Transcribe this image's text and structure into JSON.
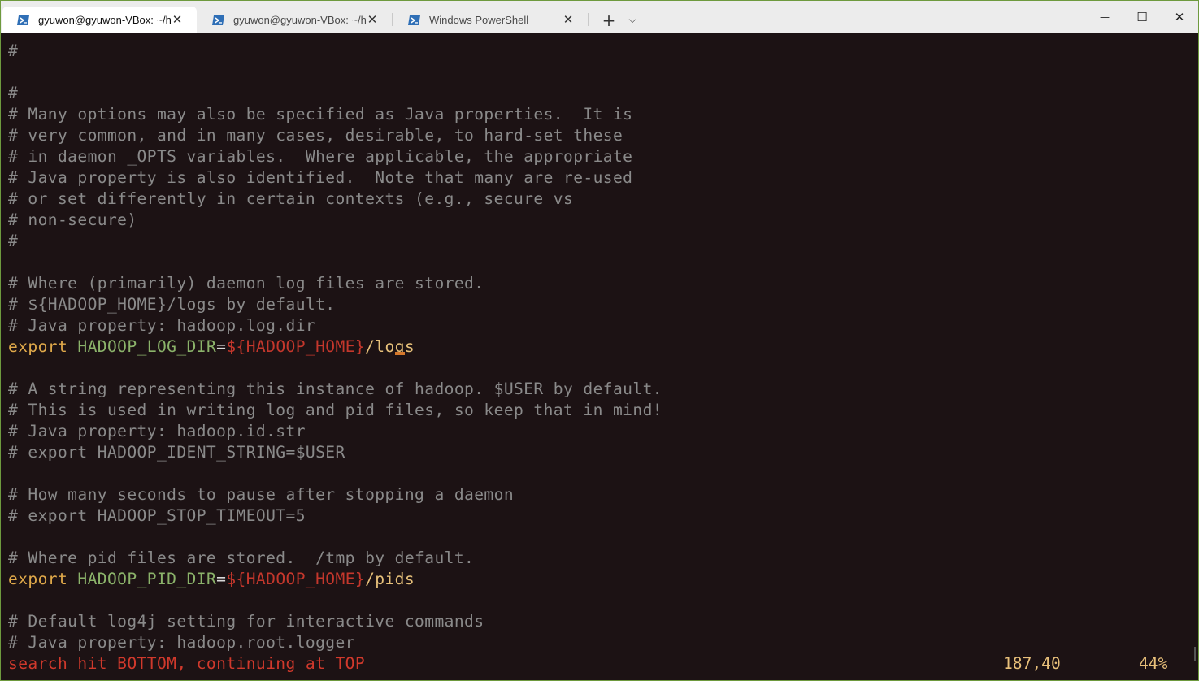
{
  "tabs": [
    {
      "label": "gyuwon@gyuwon-VBox: ~/h",
      "active": true,
      "icon": "powershell-icon"
    },
    {
      "label": "gyuwon@gyuwon-VBox: ~/ha",
      "active": false,
      "icon": "powershell-icon"
    },
    {
      "label": "Windows PowerShell",
      "active": false,
      "icon": "powershell-icon"
    }
  ],
  "tabbar": {
    "new_tab": "+",
    "dropdown": "⌵"
  },
  "window_controls": {
    "minimize": "—",
    "maximize": "☐",
    "close": "✕"
  },
  "colors": {
    "accent_border": "#6e9a3e",
    "terminal_bg": "#1c1214",
    "comment": "#8a8a8a",
    "keyword": "#e0a94a",
    "variable": "#8bb36a",
    "reference": "#c4372c",
    "error": "#d1392c"
  },
  "editor": {
    "lines": [
      "#",
      "",
      "#",
      "# Many options may also be specified as Java properties.  It is",
      "# very common, and in many cases, desirable, to hard-set these",
      "# in daemon _OPTS variables.  Where applicable, the appropriate",
      "# Java property is also identified.  Note that many are re-used",
      "# or set differently in certain contexts (e.g., secure vs",
      "# non-secure)",
      "#",
      "",
      "# Where (primarily) daemon log files are stored.",
      "# ${HADOOP_HOME}/logs by default.",
      "# Java property: hadoop.log.dir",
      "",
      "",
      "# A string representing this instance of hadoop. $USER by default.",
      "# This is used in writing log and pid files, so keep that in mind!",
      "# Java property: hadoop.id.str",
      "# export HADOOP_IDENT_STRING=$USER",
      "",
      "# How many seconds to pause after stopping a daemon",
      "# export HADOOP_STOP_TIMEOUT=5",
      "",
      "# Where pid files are stored.  /tmp by default.",
      "",
      "",
      "# Default log4j setting for interactive commands",
      "# Java property: hadoop.root.logger"
    ],
    "export_log": {
      "keyword": "export",
      "name": "HADOOP_LOG_DIR",
      "eq": "=",
      "ref": "${HADOOP_HOME}",
      "path_a": "/lo",
      "path_cursor": "g",
      "path_b": "s"
    },
    "export_pid": {
      "keyword": "export",
      "name": "HADOOP_PID_DIR",
      "eq": "=",
      "ref": "${HADOOP_HOME}",
      "path": "/pids"
    },
    "status_message": "search hit BOTTOM, continuing at TOP",
    "cursor_position": "187,40",
    "scroll_percent": "44%"
  }
}
